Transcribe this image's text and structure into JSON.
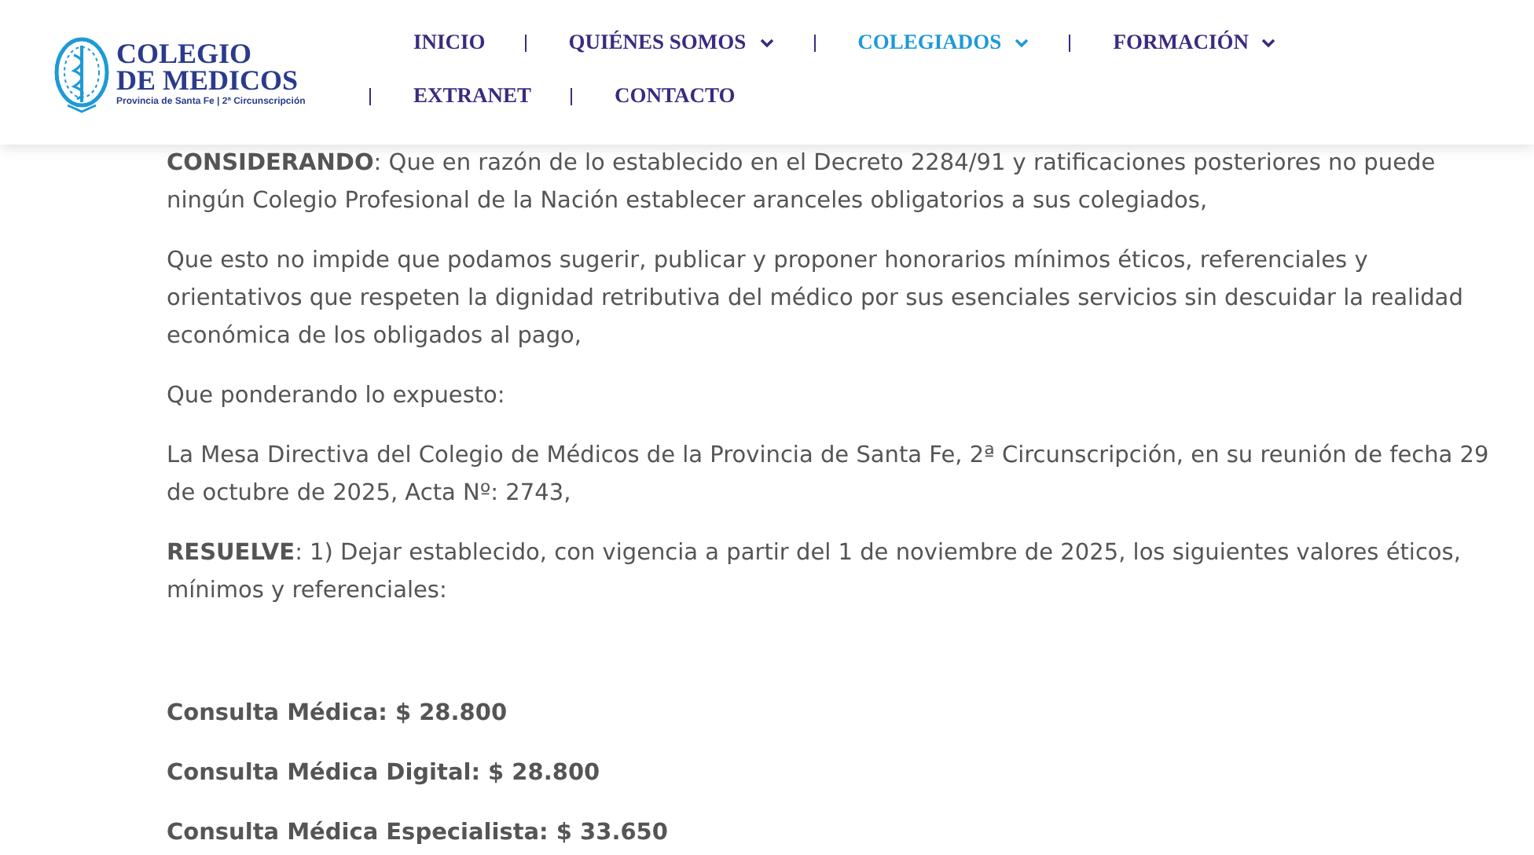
{
  "logo": {
    "title_lines": [
      "COLEGIO",
      "DE MEDICOS"
    ],
    "subtitle": "Provincia de Santa Fe | 2ª Circunscripción"
  },
  "nav": [
    {
      "label": "INICIO",
      "dropdown": false,
      "selected": false
    },
    {
      "label": "QUIÉNES SOMOS",
      "dropdown": true,
      "selected": false
    },
    {
      "label": "COLEGIADOS",
      "dropdown": true,
      "selected": true
    },
    {
      "label": "FORMACIÓN",
      "dropdown": true,
      "selected": false
    },
    {
      "label": "EXTRANET",
      "dropdown": false,
      "selected": false
    },
    {
      "label": "CONTACTO",
      "dropdown": false,
      "selected": false
    }
  ],
  "paragraphs": [
    {
      "kind": "text",
      "text": "**CONSIDERANDO**: Que en razón de lo establecido en el Decreto 2284/91 y ratificaciones posteriores no puede ningún Colegio Profesional de la Nación establecer aranceles obligatorios a sus colegiados,"
    },
    {
      "kind": "text",
      "text": "Que esto no impide que podamos sugerir, publicar y proponer honorarios mínimos éticos, referenciales y orientativos que respeten la dignidad retributiva del médico por sus esenciales servicios sin descuidar la realidad económica de los obligados al pago,"
    },
    {
      "kind": "text",
      "text": "Que ponderando lo expuesto:"
    },
    {
      "kind": "text",
      "text": "La Mesa Directiva del Colegio de Médicos de la Provincia de Santa Fe, 2ª Circunscripción, en su reunión de fecha 29 de octubre de 2025, Acta Nº: 2743,"
    },
    {
      "kind": "text",
      "text": "**RESUELVE**: 1) Dejar establecido, con vigencia a partir del 1 de noviembre de 2025, los siguientes valores éticos, mínimos y referenciales:"
    },
    {
      "kind": "price",
      "text": "Consulta Médica: $ 28.800"
    },
    {
      "kind": "price",
      "text": "Consulta Médica Digital: $ 28.800"
    },
    {
      "kind": "price",
      "text": "Consulta Médica Especialista: $ 33.650"
    }
  ]
}
